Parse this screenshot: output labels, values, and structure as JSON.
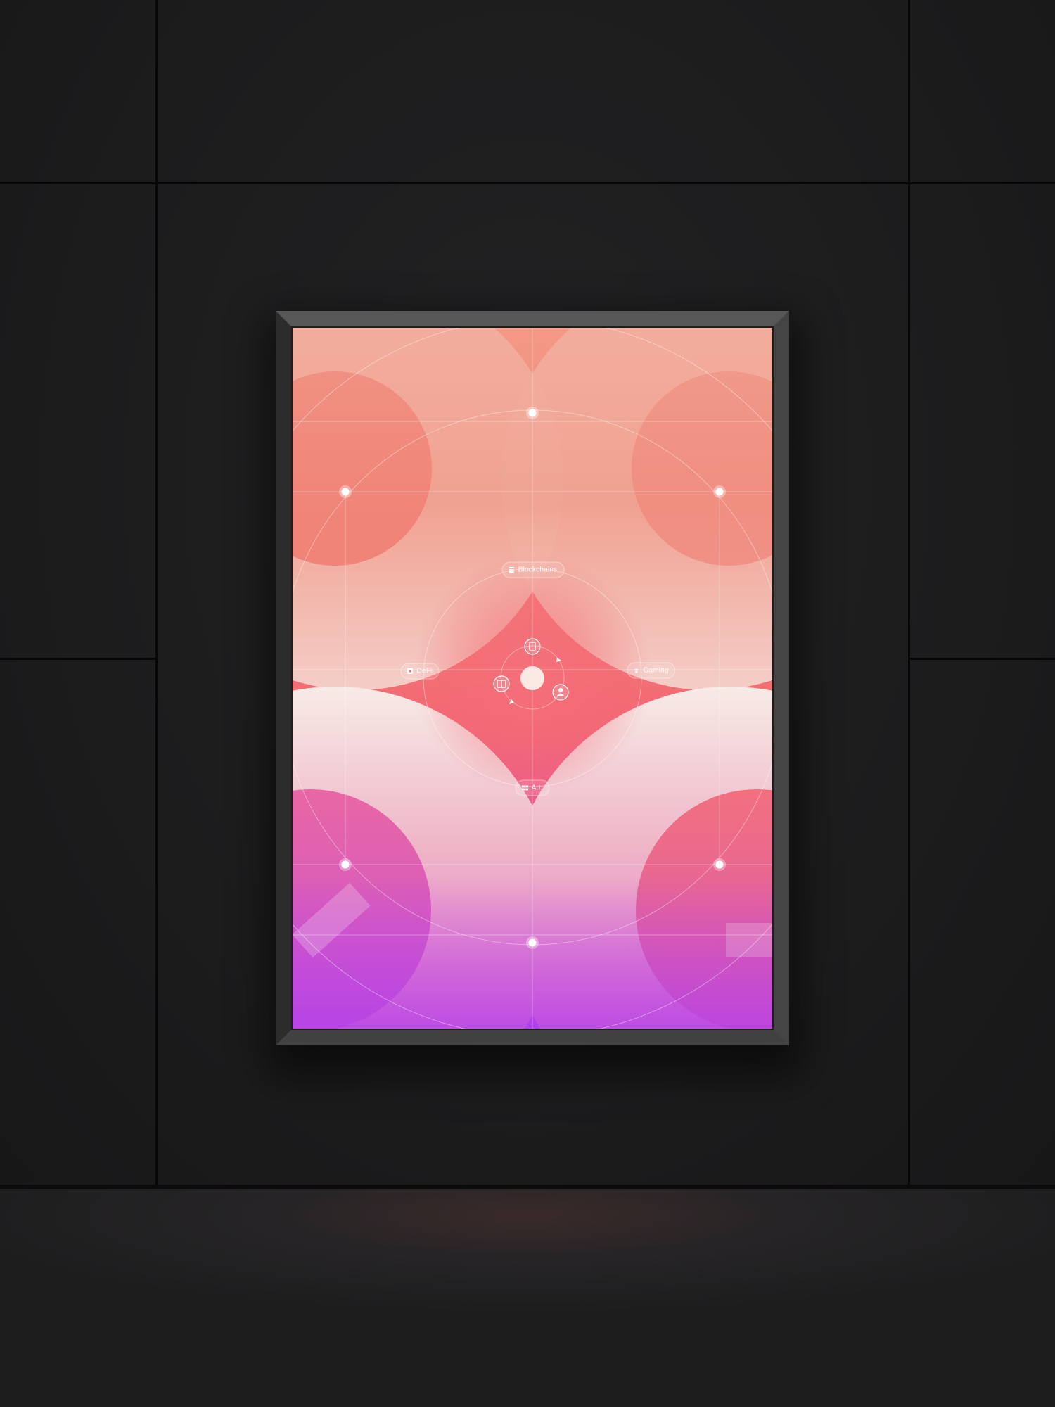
{
  "scene": {
    "wall_color": "#1c1c1d",
    "floor_color": "#232224",
    "frame_color": "#3a3a3b"
  },
  "poster": {
    "gradient": {
      "top": "#f5a08c",
      "middle": "#f36e75",
      "bottom": "#b940ea"
    },
    "labels": {
      "blockchains": "Blockchains",
      "defi": "DeFi",
      "gaming": "Gaming",
      "ai": "A.I."
    },
    "icons": {
      "blockchains": "stack-icon",
      "defi": "coin-square-icon",
      "gaming": "hat-icon",
      "ai": "chip-icon",
      "inner_top": "phone-icon",
      "inner_left": "chip-icon",
      "inner_right": "user-icon"
    }
  }
}
